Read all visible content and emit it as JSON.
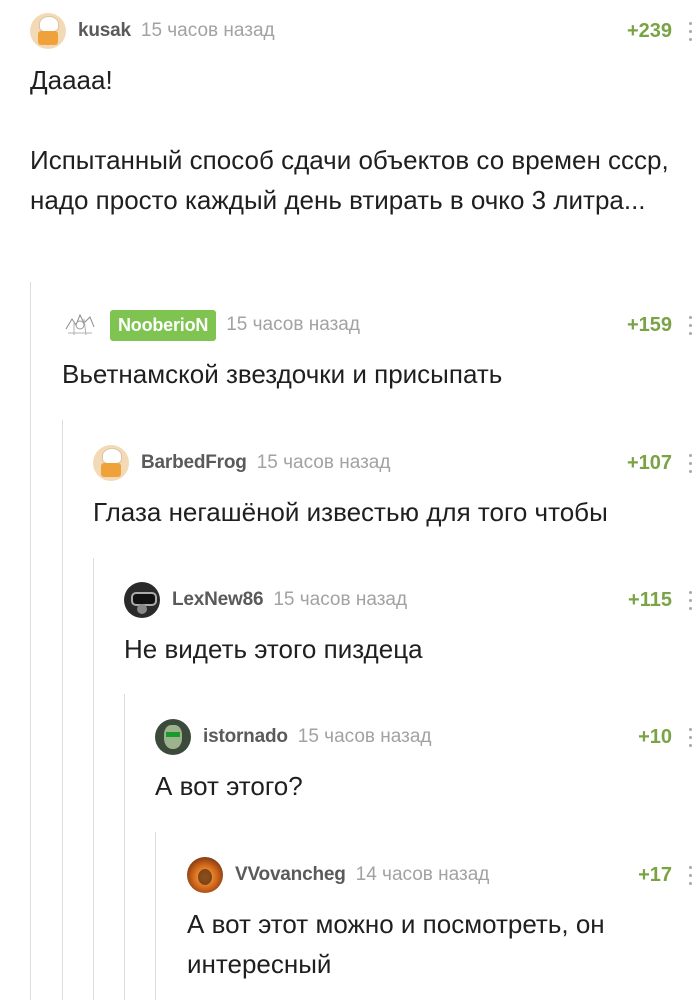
{
  "comments": [
    {
      "username": "kusak",
      "time": "15 часов назад",
      "rating": "+239",
      "avatar": "chef-icon",
      "lines": [
        "Даааа!",
        "Испытанный способ сдачи объектов со времен ссср, надо просто каждый день втирать в очко 3 литра..."
      ]
    },
    {
      "username": "NooberioN",
      "time": "15 часов назад",
      "rating": "+159",
      "avatar": "sketch-icon",
      "lines": [
        "Вьетнамской звездочки и присыпать"
      ]
    },
    {
      "username": "BarbedFrog",
      "time": "15 часов назад",
      "rating": "+107",
      "avatar": "chef-icon",
      "lines": [
        "Глаза негашёной известью для того чтобы"
      ]
    },
    {
      "username": "LexNew86",
      "time": "15 часов назад",
      "rating": "+115",
      "avatar": "raccoon-icon",
      "lines": [
        "Не видеть этого пиздеца"
      ]
    },
    {
      "username": "istornado",
      "time": "15 часов назад",
      "rating": "+10",
      "avatar": "hacker-icon",
      "lines": [
        "А вот этого?"
      ]
    },
    {
      "username": "VVovancheg",
      "time": "14 часов назад",
      "rating": "+17",
      "avatar": "fire-icon",
      "lines": [
        "А вот этот можно и посмотреть, он интересный"
      ]
    }
  ],
  "colors": {
    "rating": "#7aa444",
    "badge": "#7fc451",
    "time": "#a2a2a2",
    "username": "#5a5a5a",
    "branch": "#dcdcdc"
  }
}
